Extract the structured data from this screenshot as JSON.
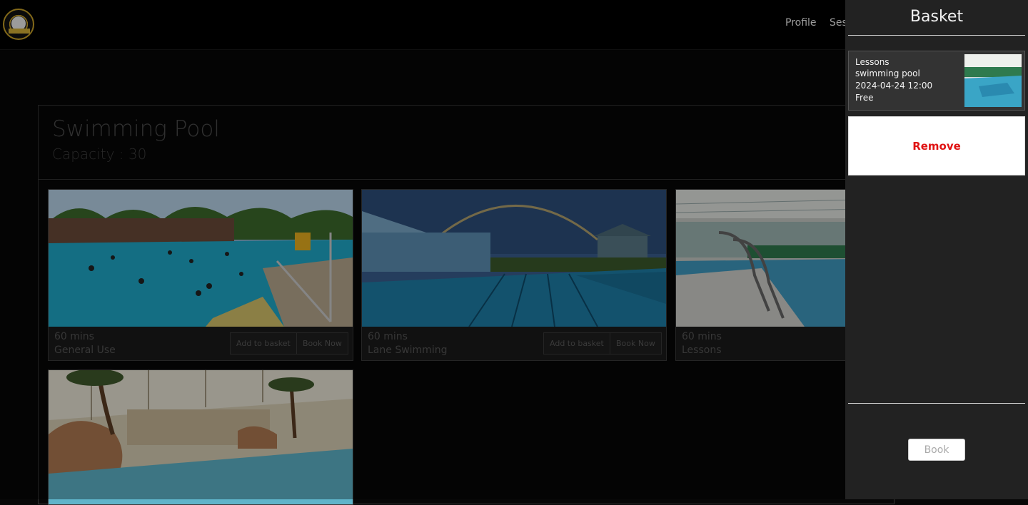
{
  "nav": {
    "links": [
      "Profile",
      "Ses"
    ]
  },
  "facility": {
    "title": "Swimming Pool",
    "capacity": "Capacity : 30"
  },
  "sessions": [
    {
      "duration": "60 mins",
      "type": "General Use",
      "add_label": "Add to basket",
      "book_label": "Book Now",
      "image": "outdoor-pool-photo"
    },
    {
      "duration": "60 mins",
      "type": "Lane Swimming",
      "add_label": "Add to basket",
      "book_label": "Book Now",
      "image": "rainbow-lido-photo"
    },
    {
      "duration": "60 mins",
      "type": "Lessons",
      "image": "indoor-pool-photo"
    },
    {
      "image": "tropical-pool-photo"
    }
  ],
  "basket": {
    "title": "Basket",
    "items": [
      {
        "session": "Lessons",
        "facility": "swimming pool",
        "datetime": "2024-04-24 12:00",
        "price": "Free",
        "image": "indoor-pool-thumb"
      }
    ],
    "remove_label": "Remove",
    "book_label": "Book"
  },
  "colors": {
    "remove": "#e01313",
    "drawer": "#222222"
  }
}
